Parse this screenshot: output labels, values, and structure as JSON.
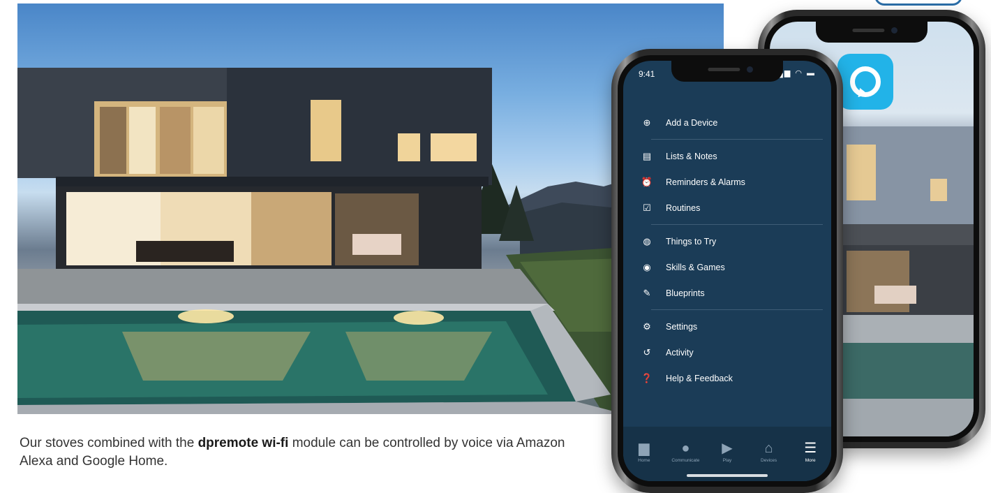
{
  "caption": {
    "before": "Our stoves combined with the ",
    "brand": "dpremote wi-fi",
    "after": " module can be controlled by voice via Amazon Alexa and Google Home."
  },
  "hero_image": {
    "icon": "modern-house-pool-photo"
  },
  "back_phone": {
    "app_icon": "alexa-app-icon",
    "accent": "#22b3e8"
  },
  "front_phone": {
    "status": {
      "time": "9:41",
      "icons": "signal-wifi-battery-icons"
    },
    "menu": [
      {
        "label": "Add a Device",
        "icon": "plus-circle-icon"
      },
      {
        "label": "Lists & Notes",
        "icon": "note-icon"
      },
      {
        "label": "Reminders & Alarms",
        "icon": "alarm-icon"
      },
      {
        "label": "Routines",
        "icon": "routine-icon"
      },
      {
        "label": "Things to Try",
        "icon": "compass-icon"
      },
      {
        "label": "Skills & Games",
        "icon": "location-pin-icon"
      },
      {
        "label": "Blueprints",
        "icon": "pencil-icon"
      },
      {
        "label": "Settings",
        "icon": "gear-icon"
      },
      {
        "label": "Activity",
        "icon": "history-icon"
      },
      {
        "label": "Help & Feedback",
        "icon": "question-icon"
      }
    ],
    "tabs": [
      {
        "label": "Home",
        "icon": "home-icon",
        "active": false
      },
      {
        "label": "Communicate",
        "icon": "chat-icon",
        "active": false
      },
      {
        "label": "Play",
        "icon": "play-icon",
        "active": false
      },
      {
        "label": "Devices",
        "icon": "devices-icon",
        "active": false
      },
      {
        "label": "More",
        "icon": "menu-icon",
        "active": true
      }
    ],
    "colors": {
      "background": "#1b3c57",
      "tabbar": "#163248",
      "divider": "#3f5d76"
    }
  }
}
